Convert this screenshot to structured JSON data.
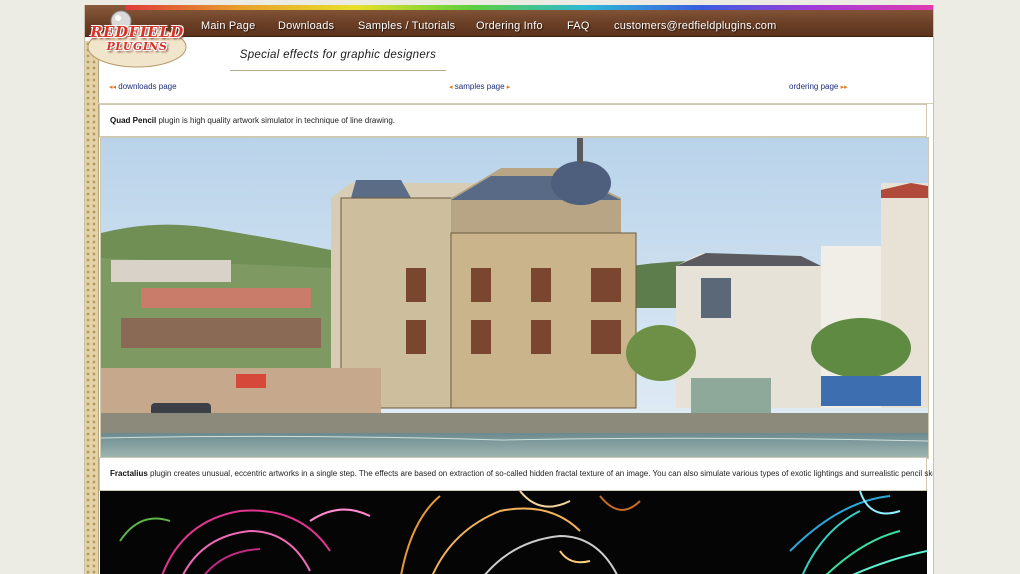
{
  "logo": {
    "line1": "REDFIELD",
    "line2": "PLUGINS"
  },
  "nav": [
    {
      "label": "Main Page"
    },
    {
      "label": "Downloads"
    },
    {
      "label": "Samples / Tutorials"
    },
    {
      "label": "Ordering Info"
    },
    {
      "label": "FAQ"
    },
    {
      "label": "customers@redfieldplugins.com"
    }
  ],
  "tagline": "Special effects for graphic designers",
  "page_links": {
    "downloads": "downloads page",
    "samples": "samples page",
    "ordering": "ordering page"
  },
  "products": [
    {
      "name": "Quad Pencil",
      "description": " plugin is high quality artwork simulator in technique of line drawing."
    },
    {
      "name": "Fractalius",
      "description": " plugin creates unusual, eccentric artworks in a single step. The effects are based on extraction of so-called hidden fractal texture of an image. You can also simulate various types of exotic lightings and surrealistic pencil sketches."
    }
  ],
  "colors": {
    "topbar": "#6a3f26",
    "link": "#1f2d7a",
    "arrow": "#e07a1a",
    "logo_red": "#d8322a"
  },
  "icons": {
    "left_arrows": "double-left-triangle-icon",
    "right_arrows": "double-right-triangle-icon"
  }
}
